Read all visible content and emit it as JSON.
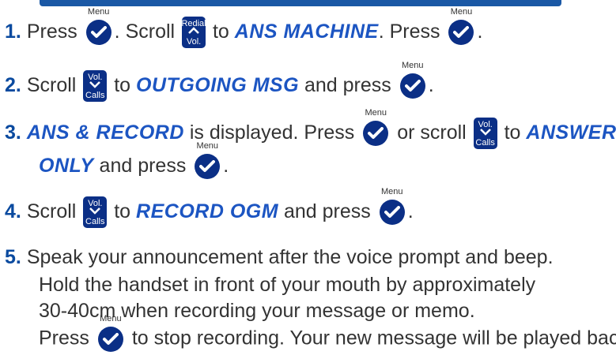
{
  "colors": {
    "key_bg": "#0b2f86",
    "step_number": "#0a4a9f",
    "lcd_text": "#1c55c2",
    "heading_bar": "#0e4fa0"
  },
  "keys": {
    "menu": "Menu",
    "redial": "Redial",
    "vol": "Vol.",
    "calls": "Calls"
  },
  "steps": [
    {
      "num": "1.",
      "t1": "Press",
      "t2": ". Scroll",
      "t3": "to",
      "lcd": "ANS MACHINE",
      "t4": ". Press",
      "t5": "."
    },
    {
      "num": "2.",
      "t1": "Scroll",
      "t2": "to",
      "lcd": "OUTGOING MSG",
      "t3": "and press",
      "t4": "."
    },
    {
      "num": "3.",
      "lcd1": "ANS & RECORD",
      "t1": "is displayed. Press",
      "t2": "or scroll",
      "t3": "to",
      "lcd2a": "ANSWER",
      "lcd2b": "ONLY",
      "t4": "and press",
      "t5": "."
    },
    {
      "num": "4.",
      "t1": "Scroll",
      "t2": "to",
      "lcd": "RECORD OGM",
      "t3": "and press",
      "t4": "."
    },
    {
      "num": "5.",
      "line1": "Speak your announcement after the voice prompt and beep.",
      "line2": "Hold the handset in front of your mouth by approximately",
      "line3": "30-40cm when recording your message or memo.",
      "t1": "Press",
      "t2": "to stop recording. Your new message will be played back."
    }
  ]
}
